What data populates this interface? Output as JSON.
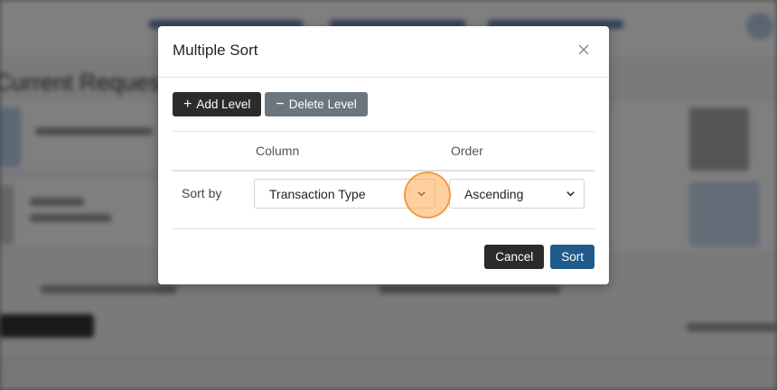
{
  "modal": {
    "title": "Multiple Sort",
    "add_level_label": "Add Level",
    "delete_level_label": "Delete Level",
    "column_header": "Column",
    "order_header": "Order",
    "sort_by_label": "Sort by",
    "column_value": "Transaction Type",
    "order_value": "Ascending",
    "cancel_label": "Cancel",
    "sort_label": "Sort"
  },
  "background": {
    "page_title": "Current Requests"
  },
  "colors": {
    "primary": "#1f5a8b",
    "dark": "#2b2b2b",
    "secondary": "#6c757d",
    "highlight": "#f5a856"
  },
  "icons": {
    "close": "close-icon",
    "add": "plus-icon",
    "delete": "minus-icon",
    "dropdown": "chevron-down-icon"
  }
}
